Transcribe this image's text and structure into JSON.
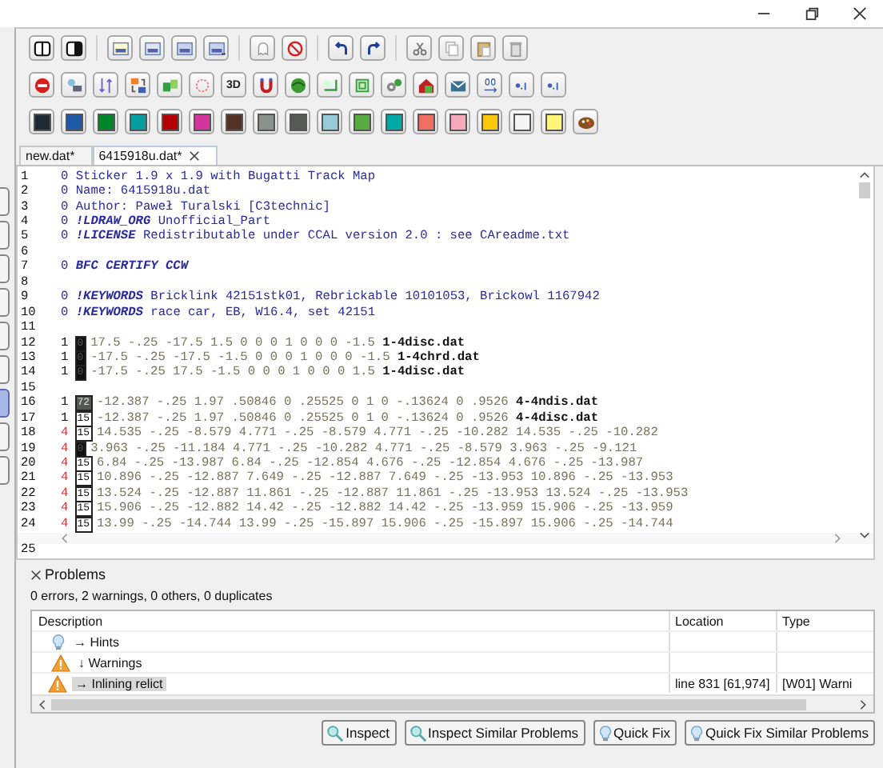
{
  "window": {
    "controls": [
      {
        "kind": "minimize"
      },
      {
        "kind": "restore"
      },
      {
        "kind": "close"
      }
    ]
  },
  "side_tabs": [
    {
      "selected": false
    },
    {
      "selected": false
    },
    {
      "selected": false
    },
    {
      "selected": false
    },
    {
      "selected": false
    },
    {
      "selected": false
    },
    {
      "selected": true
    },
    {
      "selected": false
    },
    {
      "selected": false
    }
  ],
  "toolbar_rows": [
    [
      {
        "kind": "split"
      },
      {
        "kind": "contrast"
      },
      {
        "kind": "sep"
      },
      {
        "kind": "doc-new"
      },
      {
        "kind": "doc-open"
      },
      {
        "kind": "doc-save"
      },
      {
        "kind": "doc-saveas"
      },
      {
        "kind": "sep"
      },
      {
        "kind": "ghost"
      },
      {
        "kind": "no-entry"
      },
      {
        "kind": "sep"
      },
      {
        "kind": "undo"
      },
      {
        "kind": "redo"
      },
      {
        "kind": "sep"
      },
      {
        "kind": "cut"
      },
      {
        "kind": "copy"
      },
      {
        "kind": "paste"
      },
      {
        "kind": "delete"
      }
    ],
    [
      {
        "kind": "stop"
      },
      {
        "kind": "image"
      },
      {
        "kind": "sort"
      },
      {
        "kind": "swap"
      },
      {
        "kind": "move"
      },
      {
        "kind": "circle"
      },
      {
        "kind": "text",
        "label": "3D"
      },
      {
        "kind": "magnet"
      },
      {
        "kind": "globe"
      },
      {
        "kind": "corner"
      },
      {
        "kind": "frame"
      },
      {
        "kind": "gears"
      },
      {
        "kind": "house"
      },
      {
        "kind": "envelope"
      },
      {
        "kind": "binary"
      },
      {
        "kind": "decimal"
      },
      {
        "kind": "decimal"
      }
    ],
    [
      {
        "kind": "swatch",
        "color": "#1b2a34"
      },
      {
        "kind": "swatch",
        "color": "#1e5aa8"
      },
      {
        "kind": "swatch",
        "color": "#00852b"
      },
      {
        "kind": "swatch",
        "color": "#069d9f"
      },
      {
        "kind": "swatch",
        "color": "#b40000"
      },
      {
        "kind": "swatch",
        "color": "#d3359d"
      },
      {
        "kind": "swatch",
        "color": "#543324"
      },
      {
        "kind": "swatch",
        "color": "#8a928d"
      },
      {
        "kind": "swatch",
        "color": "#545955"
      },
      {
        "kind": "swatch",
        "color": "#97cbd9"
      },
      {
        "kind": "swatch",
        "color": "#58ab41"
      },
      {
        "kind": "swatch",
        "color": "#00aaa4"
      },
      {
        "kind": "swatch",
        "color": "#f06d61"
      },
      {
        "kind": "swatch",
        "color": "#f6a9bb"
      },
      {
        "kind": "swatch",
        "color": "#fac80a"
      },
      {
        "kind": "swatch",
        "color": "#f4f4f4"
      },
      {
        "kind": "swatch",
        "color": "#fff579"
      },
      {
        "kind": "palette"
      }
    ]
  ],
  "tabs": [
    {
      "label": "new.dat*",
      "selected": false,
      "closable": false
    },
    {
      "label": "6415918u.dat*",
      "selected": true,
      "closable": true
    }
  ],
  "editor": {
    "lines": [
      {
        "n": "1",
        "segments": [
          {
            "kind": "meta",
            "text": "0 Sticker 1.9 x 1.9 with Bugatti Track Map"
          }
        ]
      },
      {
        "n": "2",
        "segments": [
          {
            "kind": "meta",
            "text": "0 Name: 6415918u.dat"
          }
        ]
      },
      {
        "n": "3",
        "segments": [
          {
            "kind": "meta",
            "text": "0 Author: Paweł Turalski [C3technic]"
          }
        ]
      },
      {
        "n": "4",
        "segments": [
          {
            "kind": "meta",
            "text": "0 "
          },
          {
            "kind": "keyword",
            "text": "!LDRAW_ORG"
          },
          {
            "kind": "meta",
            "text": " Unofficial_Part"
          }
        ]
      },
      {
        "n": "5",
        "segments": [
          {
            "kind": "meta",
            "text": "0 "
          },
          {
            "kind": "keyword",
            "text": "!LICENSE"
          },
          {
            "kind": "meta",
            "text": " Redistributable under CCAL version 2.0 : see CAreadme.txt"
          }
        ]
      },
      {
        "n": "6"
      },
      {
        "n": "7",
        "segments": [
          {
            "kind": "meta",
            "text": "0 "
          },
          {
            "kind": "keyword",
            "text": "BFC CERTIFY CCW"
          }
        ]
      },
      {
        "n": "8"
      },
      {
        "n": "9",
        "segments": [
          {
            "kind": "meta",
            "text": "0 "
          },
          {
            "kind": "keyword",
            "text": "!KEYWORDS"
          },
          {
            "kind": "meta",
            "text": " Bricklink 42151stk01, Rebrickable 10101053, Brickowl 1167942"
          }
        ]
      },
      {
        "n": "10",
        "segments": [
          {
            "kind": "meta",
            "text": "0 "
          },
          {
            "kind": "keyword",
            "text": "!KEYWORDS"
          },
          {
            "kind": "meta",
            "text": " race car, EB, W16.4, set 42151"
          }
        ]
      },
      {
        "n": "11"
      },
      {
        "n": "12",
        "segments": [
          {
            "kind": "type",
            "text": "1"
          },
          {
            "kind": "chip",
            "text": "0",
            "color": "#111111"
          },
          {
            "kind": "num",
            "text": "17.5 -.25 -17.5 1.5 0 0 0 1 0 0 0 -1.5"
          },
          {
            "kind": "file",
            "text": "1-4disc.dat"
          }
        ]
      },
      {
        "n": "13",
        "segments": [
          {
            "kind": "type",
            "text": "1"
          },
          {
            "kind": "chip",
            "text": "0",
            "color": "#111111"
          },
          {
            "kind": "num",
            "text": "-17.5 -.25 -17.5 -1.5 0 0 0 1 0 0 0 -1.5"
          },
          {
            "kind": "file",
            "text": "1-4chrd.dat"
          }
        ]
      },
      {
        "n": "14",
        "segments": [
          {
            "kind": "type",
            "text": "1"
          },
          {
            "kind": "chip",
            "text": "0",
            "color": "#111111"
          },
          {
            "kind": "num",
            "text": "-17.5 -.25 17.5 -1.5 0 0 0 1 0 0 0 1.5"
          },
          {
            "kind": "file",
            "text": "1-4disc.dat"
          }
        ]
      },
      {
        "n": "15"
      },
      {
        "n": "16",
        "segments": [
          {
            "kind": "type",
            "text": "1"
          },
          {
            "kind": "chip",
            "text": "72",
            "color": "#545955"
          },
          {
            "kind": "num",
            "text": "-12.387 -.25 1.97 .50846 0 .25525 0 1 0 -.13624 0 .9526"
          },
          {
            "kind": "file",
            "text": "4-4ndis.dat"
          }
        ]
      },
      {
        "n": "17",
        "segments": [
          {
            "kind": "type",
            "text": "1"
          },
          {
            "kind": "chip",
            "text": "15",
            "color": "#ffffff"
          },
          {
            "kind": "num",
            "text": "-12.387 -.25 1.97 .50846 0 .25525 0 1 0 -.13624 0 .9526"
          },
          {
            "kind": "file",
            "text": "4-4disc.dat"
          }
        ]
      },
      {
        "n": "18",
        "segments": [
          {
            "kind": "quad",
            "text": "4"
          },
          {
            "kind": "chip",
            "text": "15",
            "color": "#ffffff"
          },
          {
            "kind": "num",
            "text": "14.535 -.25 -8.579 4.771 -.25 -8.579 4.771 -.25 -10.282 14.535 -.25 -10.282"
          }
        ]
      },
      {
        "n": "19",
        "segments": [
          {
            "kind": "quad",
            "text": "4"
          },
          {
            "kind": "chip",
            "text": "0",
            "color": "#111111"
          },
          {
            "kind": "num",
            "text": "3.963 -.25 -11.184 4.771 -.25 -10.282 4.771 -.25 -8.579 3.963 -.25 -9.121"
          }
        ]
      },
      {
        "n": "20",
        "segments": [
          {
            "kind": "quad",
            "text": "4"
          },
          {
            "kind": "chip",
            "text": "15",
            "color": "#ffffff"
          },
          {
            "kind": "num",
            "text": "6.84 -.25 -13.987 6.84 -.25 -12.854 4.676 -.25 -12.854 4.676 -.25 -13.987"
          }
        ]
      },
      {
        "n": "21",
        "segments": [
          {
            "kind": "quad",
            "text": "4"
          },
          {
            "kind": "chip",
            "text": "15",
            "color": "#ffffff"
          },
          {
            "kind": "num",
            "text": "10.896 -.25 -12.887 7.649 -.25 -12.887 7.649 -.25 -13.953 10.896 -.25 -13.953"
          }
        ]
      },
      {
        "n": "22",
        "segments": [
          {
            "kind": "quad",
            "text": "4"
          },
          {
            "kind": "chip",
            "text": "15",
            "color": "#ffffff"
          },
          {
            "kind": "num",
            "text": "13.524 -.25 -12.887 11.861 -.25 -12.887 11.861 -.25 -13.953 13.524 -.25 -13.953"
          }
        ]
      },
      {
        "n": "23",
        "segments": [
          {
            "kind": "quad",
            "text": "4"
          },
          {
            "kind": "chip",
            "text": "15",
            "color": "#ffffff"
          },
          {
            "kind": "num",
            "text": "15.906 -.25 -12.882 14.42 -.25 -12.882 14.42 -.25 -13.959 15.906 -.25 -13.959"
          }
        ]
      },
      {
        "n": "24",
        "segments": [
          {
            "kind": "quad",
            "text": "4"
          },
          {
            "kind": "chip",
            "text": "15",
            "color": "#ffffff"
          },
          {
            "kind": "num",
            "text": "13.99 -.25 -14.744 13.99 -.25 -15.897 15.906 -.25 -15.897 15.906 -.25 -14.744"
          }
        ]
      }
    ],
    "after_scroll_line": "25"
  },
  "problems": {
    "title": "Problems",
    "summary": "0 errors, 2 warnings, 0 others, 0 duplicates",
    "columns": [
      "Description",
      "Location",
      "Type"
    ],
    "rows": [
      {
        "kind": "hint",
        "label": "→ Hints",
        "selected": false
      },
      {
        "kind": "warning",
        "label": "↓ Warnings",
        "selected": false,
        "children": [
          {
            "kind": "warning",
            "label": "→ Inlining relict",
            "location": "line 831   [61,974]",
            "type": "[W01] Warni",
            "selected": true
          }
        ]
      }
    ],
    "buttons": [
      {
        "kind": "inspect",
        "label": "Inspect"
      },
      {
        "kind": "inspect",
        "label": "Inspect Similar Problems"
      },
      {
        "kind": "fix",
        "label": "Quick Fix"
      },
      {
        "kind": "fix",
        "label": "Quick Fix Similar Problems"
      }
    ]
  }
}
